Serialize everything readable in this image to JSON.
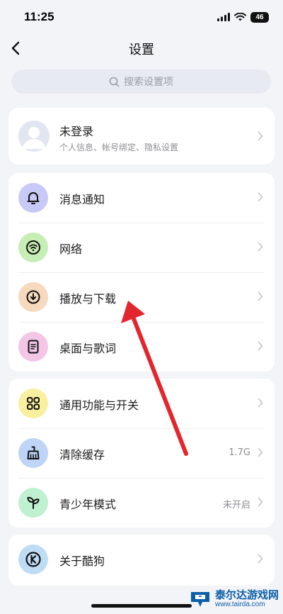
{
  "status": {
    "time": "11:25",
    "battery": "46"
  },
  "header": {
    "title": "设置"
  },
  "search": {
    "placeholder": "搜索设置项"
  },
  "profile": {
    "name": "未登录",
    "subtitle": "个人信息、帐号绑定、隐私设置"
  },
  "group1": {
    "items": [
      {
        "label": "消息通知",
        "icon": "bell-icon",
        "color": "#c9c9f7"
      },
      {
        "label": "网络",
        "icon": "wifi-icon",
        "color": "#c6eeb5"
      },
      {
        "label": "播放与下载",
        "icon": "download-icon",
        "color": "#f7d9bd"
      },
      {
        "label": "桌面与歌词",
        "icon": "lyrics-icon",
        "color": "#f3c6e6"
      }
    ]
  },
  "group2": {
    "items": [
      {
        "label": "通用功能与开关",
        "icon": "grid-icon",
        "color": "#f8ef9f"
      },
      {
        "label": "清除缓存",
        "icon": "broom-icon",
        "color": "#bed5f7",
        "value": "1.7G"
      },
      {
        "label": "青少年模式",
        "icon": "sprout-icon",
        "color": "#bff0cf",
        "value": "未开启"
      }
    ]
  },
  "group3": {
    "items": [
      {
        "label": "关于酷狗",
        "icon": "kugou-logo-icon",
        "color": "#bfdcf5"
      }
    ]
  },
  "watermark": {
    "title": "泰尔达游戏网",
    "url": "www.tairda.com"
  },
  "colors": {
    "background": "#f3f4f8",
    "card": "#ffffff",
    "annotation_arrow": "#e3262e"
  }
}
